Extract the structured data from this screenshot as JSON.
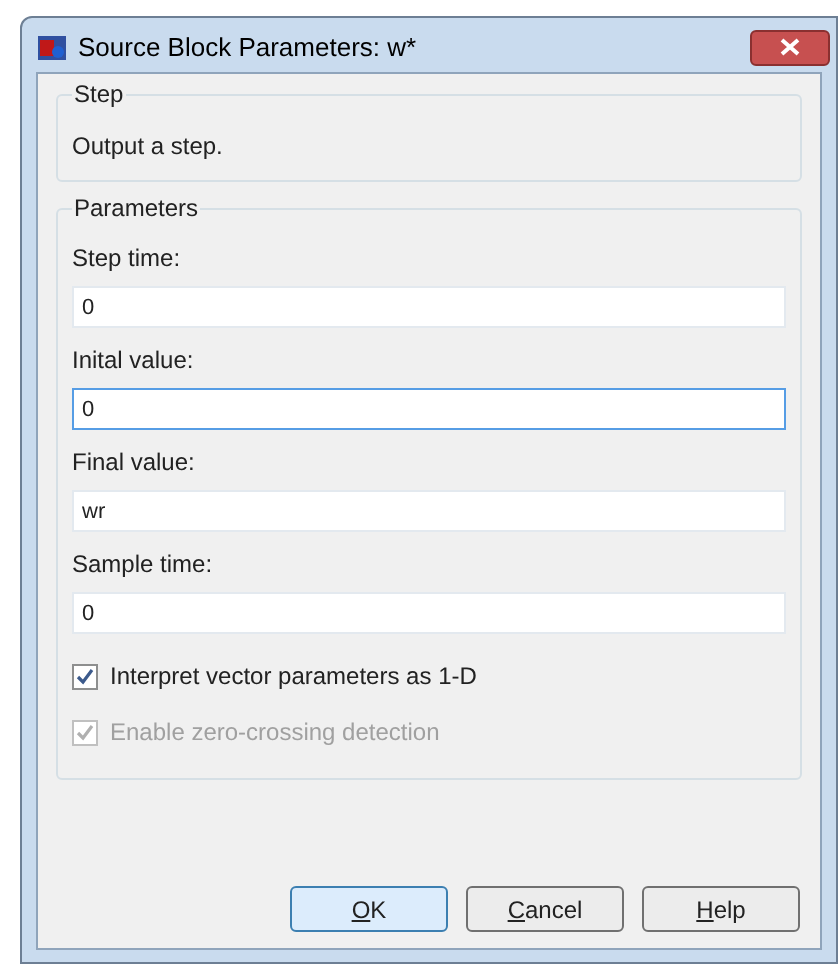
{
  "window": {
    "title": "Source Block Parameters: w*"
  },
  "description_group": {
    "title": "Step",
    "text": "Output a step."
  },
  "parameters_group": {
    "title": "Parameters",
    "fields": [
      {
        "label": "Step time:",
        "value": "0",
        "focused": false
      },
      {
        "label": "Inital value:",
        "value": "0",
        "focused": true
      },
      {
        "label": "Final value:",
        "value": "wr",
        "focused": false
      },
      {
        "label": "Sample time:",
        "value": "0",
        "focused": false
      }
    ],
    "checkboxes": [
      {
        "label": "Interpret vector parameters as 1-D",
        "checked": true,
        "disabled": false
      },
      {
        "label": "Enable zero-crossing detection",
        "checked": true,
        "disabled": true
      }
    ]
  },
  "buttons": [
    {
      "label": "OK",
      "default": true,
      "mnemonic_underlined": true
    },
    {
      "label": "Cancel",
      "default": false,
      "mnemonic_underlined": true
    },
    {
      "label": "Help",
      "default": false,
      "mnemonic_underlined": true
    }
  ]
}
